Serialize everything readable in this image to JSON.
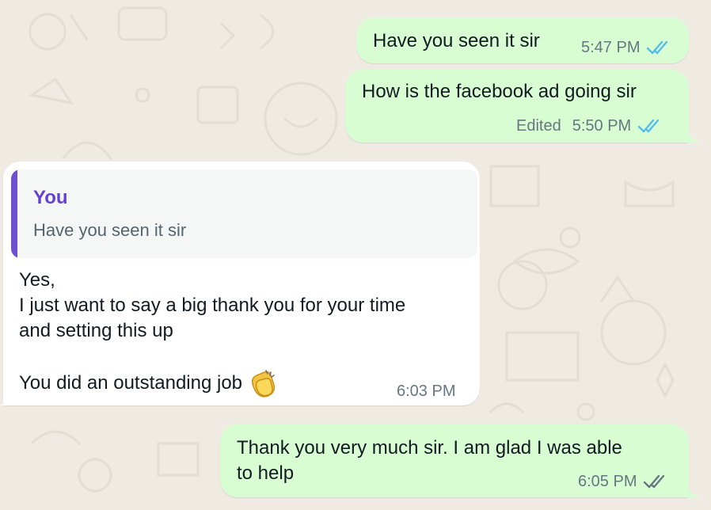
{
  "colors": {
    "outgoing_bubble": "#d9fdd3",
    "incoming_bubble": "#ffffff",
    "read_ticks": "#53bdeb",
    "sent_ticks": "#667781",
    "quote_accent": "#6d4fcf",
    "background": "#efeae2"
  },
  "messages": [
    {
      "direction": "outgoing",
      "text": "Have you seen it sir",
      "time": "5:47 PM",
      "status": "read"
    },
    {
      "direction": "outgoing",
      "text": "How is the facebook ad going sir",
      "edited_label": "Edited",
      "time": "5:50 PM",
      "status": "read"
    },
    {
      "direction": "incoming",
      "quote": {
        "author": "You",
        "text": "Have you seen it sir"
      },
      "lines": [
        "Yes,",
        "I just want to say a big thank you for your time",
        "and setting this up",
        "You did an outstanding job"
      ],
      "emoji": "clapping-hands",
      "time": "6:03 PM"
    },
    {
      "direction": "outgoing",
      "lines": [
        "Thank you very much sir. I am glad I was able",
        "to help"
      ],
      "time": "6:05 PM",
      "status": "delivered"
    }
  ]
}
